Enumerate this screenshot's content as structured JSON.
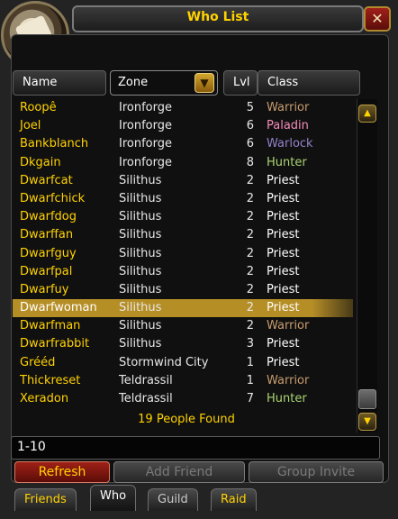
{
  "window": {
    "title": "Who List"
  },
  "columns": {
    "name": "Name",
    "zone": "Zone",
    "level": "Lvl",
    "class": "Class"
  },
  "rows": [
    {
      "name": "Roopê",
      "zone": "Ironforge",
      "level": "5",
      "class": "Warrior",
      "class_color": "#c79c6e"
    },
    {
      "name": "Joel",
      "zone": "Ironforge",
      "level": "6",
      "class": "Paladin",
      "class_color": "#f58cba"
    },
    {
      "name": "Bankblanch",
      "zone": "Ironforge",
      "level": "6",
      "class": "Warlock",
      "class_color": "#9482c9"
    },
    {
      "name": "Dkgain",
      "zone": "Ironforge",
      "level": "8",
      "class": "Hunter",
      "class_color": "#abd473"
    },
    {
      "name": "Dwarfcat",
      "zone": "Silithus",
      "level": "2",
      "class": "Priest",
      "class_color": "#ffffff"
    },
    {
      "name": "Dwarfchick",
      "zone": "Silithus",
      "level": "2",
      "class": "Priest",
      "class_color": "#ffffff"
    },
    {
      "name": "Dwarfdog",
      "zone": "Silithus",
      "level": "2",
      "class": "Priest",
      "class_color": "#ffffff"
    },
    {
      "name": "Dwarffan",
      "zone": "Silithus",
      "level": "2",
      "class": "Priest",
      "class_color": "#ffffff"
    },
    {
      "name": "Dwarfguy",
      "zone": "Silithus",
      "level": "2",
      "class": "Priest",
      "class_color": "#ffffff"
    },
    {
      "name": "Dwarfpal",
      "zone": "Silithus",
      "level": "2",
      "class": "Priest",
      "class_color": "#ffffff"
    },
    {
      "name": "Dwarfuy",
      "zone": "Silithus",
      "level": "2",
      "class": "Priest",
      "class_color": "#ffffff"
    },
    {
      "name": "Dwarfwoman",
      "zone": "Silithus",
      "level": "2",
      "class": "Priest",
      "class_color": "#ffffff",
      "selected": true
    },
    {
      "name": "Dwarfman",
      "zone": "Silithus",
      "level": "2",
      "class": "Warrior",
      "class_color": "#c79c6e"
    },
    {
      "name": "Dwarfrabbit",
      "zone": "Silithus",
      "level": "3",
      "class": "Priest",
      "class_color": "#ffffff"
    },
    {
      "name": "Grééd",
      "zone": "Stormwind City",
      "level": "1",
      "class": "Priest",
      "class_color": "#ffffff"
    },
    {
      "name": "Thickreset",
      "zone": "Teldrassil",
      "level": "1",
      "class": "Warrior",
      "class_color": "#c79c6e"
    },
    {
      "name": "Xeradon",
      "zone": "Teldrassil",
      "level": "7",
      "class": "Hunter",
      "class_color": "#abd473"
    }
  ],
  "footer": {
    "found": "19 People Found",
    "search_value": "1-10"
  },
  "buttons": {
    "refresh": "Refresh",
    "add_friend": "Add Friend",
    "group_invite": "Group Invite"
  },
  "tabs": [
    {
      "label": "Friends"
    },
    {
      "label": "Who"
    },
    {
      "label": "Guild"
    },
    {
      "label": "Raid"
    }
  ],
  "icons": {
    "close": "close-icon",
    "zone_dropdown": "chevron-down-icon",
    "scroll_up": "chevron-up-icon",
    "scroll_down": "chevron-down-icon",
    "portrait": "scroll-icon"
  }
}
